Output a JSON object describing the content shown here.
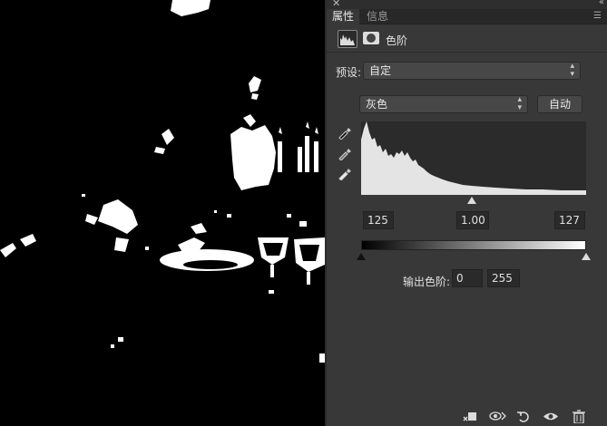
{
  "panel": {
    "tabs": [
      {
        "label": "属性"
      },
      {
        "label": "信息"
      }
    ],
    "adjustment_title": "色阶",
    "preset_label": "预设:",
    "preset_value": "自定",
    "channel_value": "灰色",
    "auto_label": "自动",
    "input_levels": {
      "black": "125",
      "gamma": "1.00",
      "white": "127"
    },
    "output_label": "输出色阶:",
    "output_levels": {
      "black": "0",
      "white": "255"
    }
  },
  "icons": {
    "close": "close-icon",
    "collapse": "double-arrow-icon",
    "panel_menu": "panel-menu-icon",
    "levels": "levels-histogram-icon",
    "mask": "layer-mask-icon",
    "eyedroppers": [
      "black-point-eyedropper-icon",
      "gray-point-eyedropper-icon",
      "white-point-eyedropper-icon"
    ],
    "bottom": [
      "clip-to-layer-icon",
      "view-previous-state-icon",
      "reset-icon",
      "visibility-eye-icon",
      "trash-icon"
    ]
  },
  "colors": {
    "panel_bg": "#383838",
    "tab_bar_bg": "#282828",
    "field_bg": "#474747",
    "histogram_bg": "#2b2b2b",
    "histogram_fill": "#e4e4e4"
  }
}
